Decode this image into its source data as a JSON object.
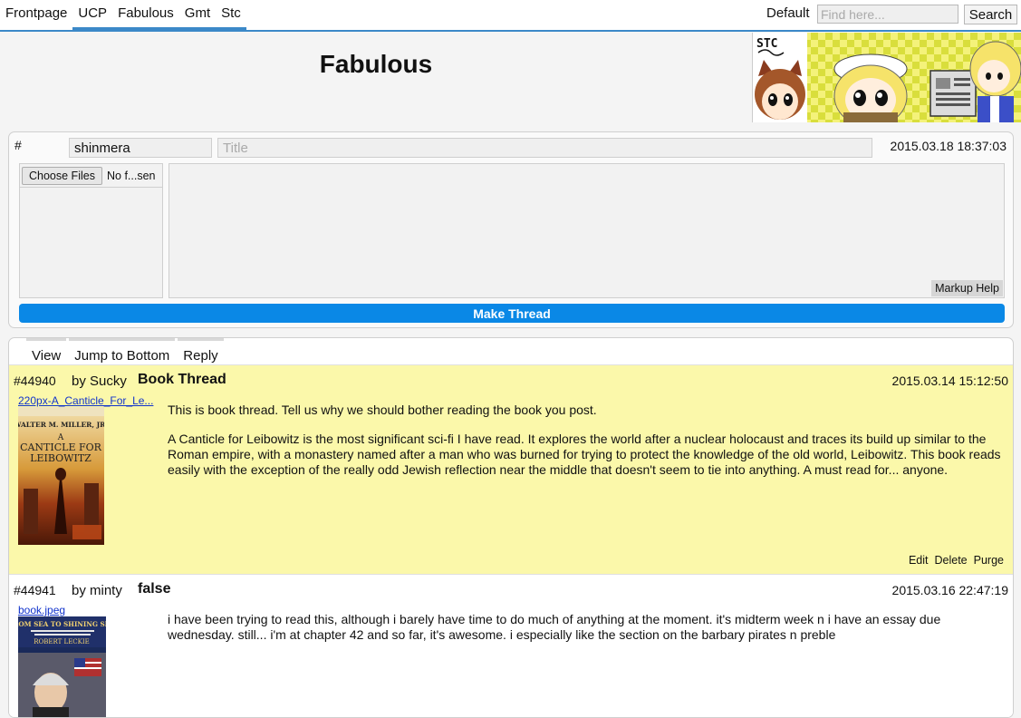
{
  "nav": {
    "links": [
      "Frontpage",
      "UCP",
      "Fabulous",
      "Gmt",
      "Stc"
    ],
    "theme_label": "Default",
    "search_placeholder": "Find here...",
    "search_button": "Search"
  },
  "header": {
    "board_title": "Fabulous",
    "banner_text": "STC"
  },
  "post_form": {
    "hash": "#",
    "author_value": "shinmera",
    "title_placeholder": "Title",
    "date": "2015.03.18 18:37:03",
    "choose_files_label": "Choose Files",
    "no_file_label": "No f...sen",
    "markup_help_label": "Markup Help",
    "submit_label": "Make Thread"
  },
  "thread": {
    "nav": [
      "View",
      "Jump to Bottom",
      "Reply"
    ],
    "posts": [
      {
        "id": "#44940",
        "author": "by Sucky",
        "title": "Book Thread",
        "date": "2015.03.14 15:12:50",
        "file_name": "220px-A_Canticle_For_Le...",
        "cover": {
          "author_name": "WALTER M. MILLER, JR.",
          "title_line1": "A",
          "title_line2": "CANTICLE FOR",
          "title_line3": "LEIBOWITZ"
        },
        "paragraphs": [
          "This is book thread. Tell us why we should bother reading the book you post.",
          "A Canticle for Leibowitz is the most significant sci-fi I have read. It explores the world after a nuclear holocaust and traces its build up similar to the Roman empire, with a monastery named after a man who was burned for trying to protect the knowledge of the old world, Leibowitz. This book reads easily with the exception of the really odd Jewish reflection near the middle that doesn't seem to tie into anything. A must read for... anyone."
        ],
        "actions": [
          "Edit",
          "Delete",
          "Purge"
        ]
      },
      {
        "id": "#44941",
        "author": "by minty",
        "title": "false",
        "date": "2015.03.16 22:47:19",
        "file_name": "book.jpeg",
        "cover": {
          "title": "FROM SEA TO SHINING SEA",
          "author_name": "ROBERT LECKIE"
        },
        "paragraphs": [
          "i have been trying to read this, although i barely have time to do much of anything at the moment. it's midterm week n i have an essay due wednesday. still...  i'm at chapter 42 and so far, it's awesome. i especially like the section on the barbary pirates n preble"
        ]
      }
    ]
  }
}
